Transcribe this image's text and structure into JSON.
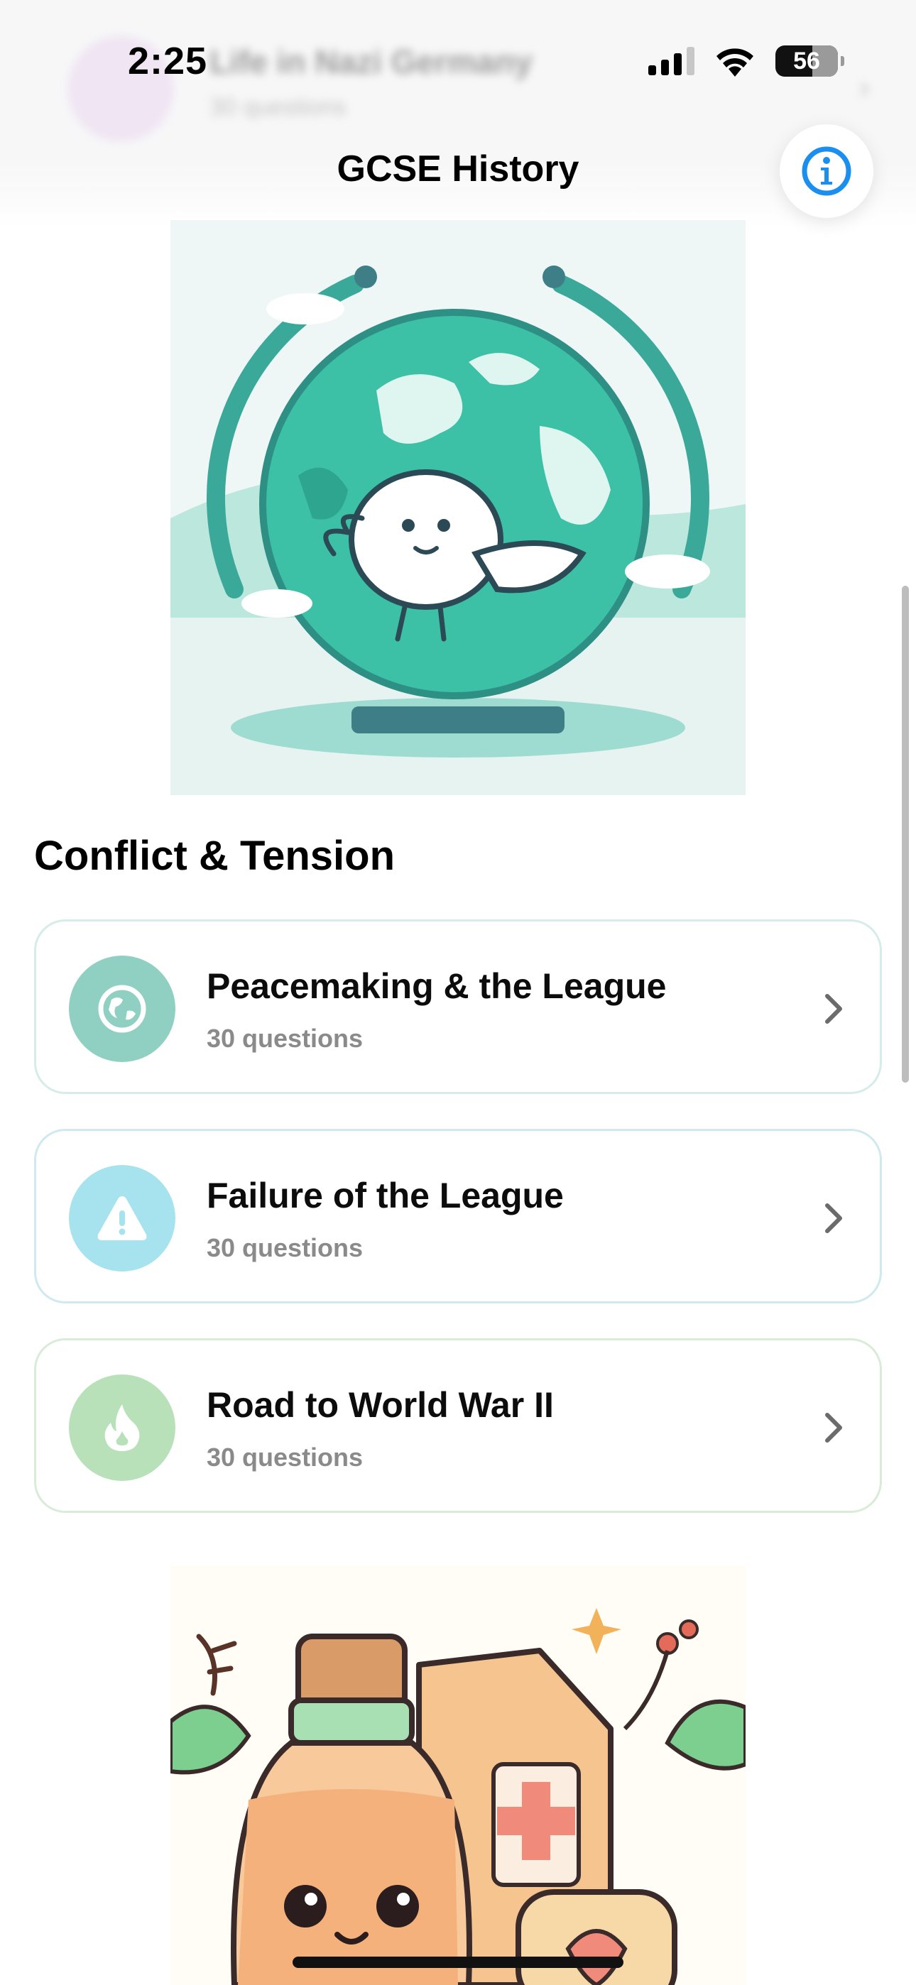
{
  "status_bar": {
    "time": "2:25",
    "battery": "56"
  },
  "header_ghost": {
    "title": "Life in Nazi Germany",
    "subtitle": "30 questions"
  },
  "nav": {
    "title": "GCSE History",
    "info_icon": "info-icon"
  },
  "section": {
    "title": "Conflict & Tension"
  },
  "topics": [
    {
      "title": "Peacemaking & the League",
      "subtitle": "30 questions",
      "icon": "globe-icon",
      "icon_bg": "#8fd0c3"
    },
    {
      "title": "Failure of the League",
      "subtitle": "30 questions",
      "icon": "warning-icon",
      "icon_bg": "#a6e3ee"
    },
    {
      "title": "Road to World War II",
      "subtitle": "30 questions",
      "icon": "flame-icon",
      "icon_bg": "#b9e1b9"
    }
  ],
  "colors": {
    "accent": "#1a8ff0",
    "teal": "#3dbfa8",
    "card_border": "#d6ece8"
  }
}
